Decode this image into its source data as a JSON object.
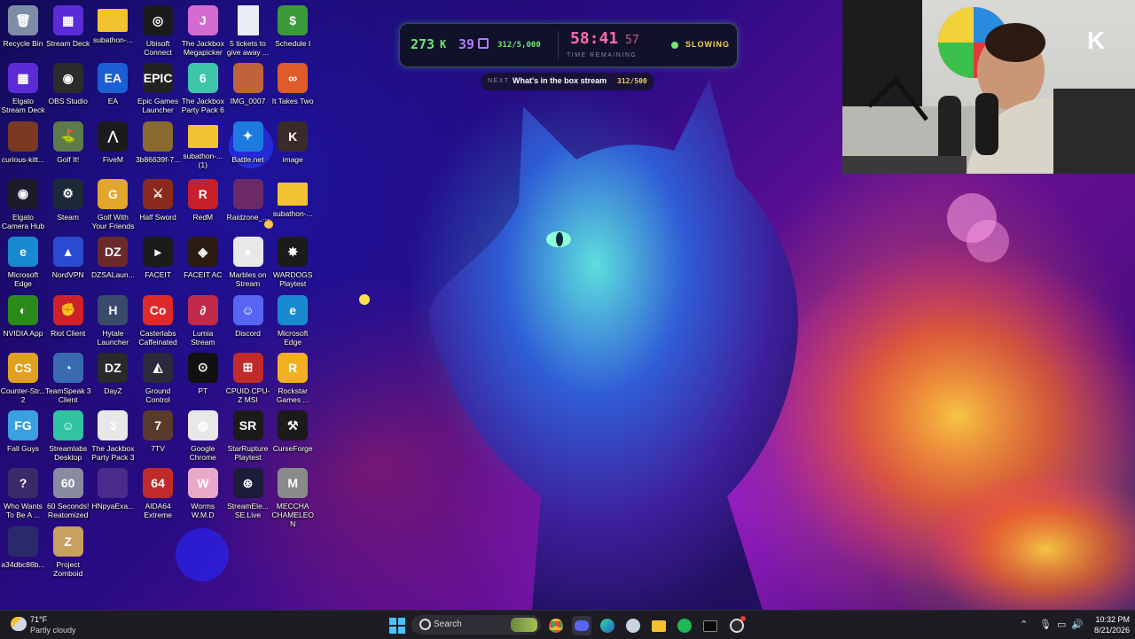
{
  "desktop": {
    "icons": [
      {
        "label": "Recycle Bin",
        "icon": "recycle-bin-icon",
        "color": "#7d8da6",
        "glyph": "🗑"
      },
      {
        "label": "Stream Deck",
        "icon": "stream-deck-icon",
        "color": "#5b2bd6",
        "glyph": "▦"
      },
      {
        "label": "subathon-...",
        "icon": "folder-icon",
        "color": "#f2c230",
        "glyph": ""
      },
      {
        "label": "Ubisoft Connect",
        "icon": "ubisoft-icon",
        "color": "#1a1a1a",
        "glyph": "◎"
      },
      {
        "label": "The Jackbox Megapicker",
        "icon": "jackbox-icon",
        "color": "#d36bd0",
        "glyph": "J"
      },
      {
        "label": "5 tickets to give away ...",
        "icon": "text-document-icon",
        "color": "#e9eef4",
        "glyph": ""
      },
      {
        "label": "Schedule I",
        "icon": "schedule-icon",
        "color": "#3a9a3a",
        "glyph": "$"
      },
      {
        "label": "Elgato Stream Deck",
        "icon": "stream-deck-icon",
        "color": "#5b2bd6",
        "glyph": "▦"
      },
      {
        "label": "OBS Studio",
        "icon": "obs-icon",
        "color": "#2b2b2b",
        "glyph": "◉"
      },
      {
        "label": "EA",
        "icon": "ea-icon",
        "color": "#1b5fd3",
        "glyph": "EA"
      },
      {
        "label": "Epic Games Launcher",
        "icon": "epic-games-icon",
        "color": "#222222",
        "glyph": "EPIC"
      },
      {
        "label": "The Jackbox Party Pack 6",
        "icon": "jackbox-icon",
        "color": "#3fc6a8",
        "glyph": "6"
      },
      {
        "label": "IMG_0007",
        "icon": "image-file-icon",
        "color": "#c0623a",
        "glyph": ""
      },
      {
        "label": "It Takes Two",
        "icon": "game-icon",
        "color": "#e05a2a",
        "glyph": "∞"
      },
      {
        "label": "curious-kitt...",
        "icon": "image-file-icon",
        "color": "#7a3a22",
        "glyph": ""
      },
      {
        "label": "Golf It!",
        "icon": "golf-it-icon",
        "color": "#5d7b4a",
        "glyph": "⛳"
      },
      {
        "label": "FiveM",
        "icon": "fivem-icon",
        "color": "#1b1b1b",
        "glyph": "⋀"
      },
      {
        "label": "3b86639f-7...",
        "icon": "image-file-icon",
        "color": "#8a6a30",
        "glyph": ""
      },
      {
        "label": "subathon-... (1)",
        "icon": "folder-icon",
        "color": "#f2c230",
        "glyph": ""
      },
      {
        "label": "Battle.net",
        "icon": "battlenet-icon",
        "color": "#1d7be0",
        "glyph": "✦"
      },
      {
        "label": "image",
        "icon": "image-file-icon",
        "color": "#3a2a2a",
        "glyph": "K"
      },
      {
        "label": "Elgato Camera Hub",
        "icon": "camera-hub-icon",
        "color": "#1b1b2a",
        "glyph": "◉"
      },
      {
        "label": "Steam",
        "icon": "steam-icon",
        "color": "#1b2838",
        "glyph": "⚙"
      },
      {
        "label": "Golf With Your Friends",
        "icon": "golf-icon",
        "color": "#e2a62a",
        "glyph": "G"
      },
      {
        "label": "Half Sword",
        "icon": "half-sword-icon",
        "color": "#8a2a1a",
        "glyph": "⚔"
      },
      {
        "label": "RedM",
        "icon": "redm-icon",
        "color": "#c8202a",
        "glyph": "R"
      },
      {
        "label": "Raidzone_...",
        "icon": "image-file-icon",
        "color": "#6a2a6a",
        "glyph": ""
      },
      {
        "label": "subathon-...",
        "icon": "folder-icon",
        "color": "#f2c230",
        "glyph": ""
      },
      {
        "label": "Microsoft Edge",
        "icon": "edge-icon",
        "color": "#1a8ad0",
        "glyph": "e"
      },
      {
        "label": "NordVPN",
        "icon": "nordvpn-icon",
        "color": "#2a4ad0",
        "glyph": "▲"
      },
      {
        "label": "DZSALaun...",
        "icon": "dzsa-icon",
        "color": "#6a2a2a",
        "glyph": "DZ"
      },
      {
        "label": "FACEIT",
        "icon": "faceit-icon",
        "color": "#1b1b1b",
        "glyph": "▸"
      },
      {
        "label": "FACEIT AC",
        "icon": "faceit-ac-icon",
        "color": "#2a1b10",
        "glyph": "◈"
      },
      {
        "label": "Marbles on Stream",
        "icon": "marbles-icon",
        "color": "#e8e8e8",
        "glyph": "●"
      },
      {
        "label": "WARDOGS Playtest",
        "icon": "wardogs-icon",
        "color": "#1b1b1b",
        "glyph": "✸"
      },
      {
        "label": "NVIDIA App",
        "icon": "nvidia-icon",
        "color": "#2a8a1a",
        "glyph": "◐"
      },
      {
        "label": "Riot Client",
        "icon": "riot-icon",
        "color": "#d0202a",
        "glyph": "✊"
      },
      {
        "label": "Hytale Launcher",
        "icon": "hytale-icon",
        "color": "#3a4a6a",
        "glyph": "H"
      },
      {
        "label": "Casterlabs Caffeinated",
        "icon": "casterlabs-icon",
        "color": "#e02a2a",
        "glyph": "Co"
      },
      {
        "label": "Lumia Stream",
        "icon": "lumia-icon",
        "color": "#c02a4a",
        "glyph": "∂"
      },
      {
        "label": "Discord",
        "icon": "discord-icon",
        "color": "#5865f2",
        "glyph": "☺"
      },
      {
        "label": "Microsoft Edge",
        "icon": "edge-icon",
        "color": "#1a8ad0",
        "glyph": "e"
      },
      {
        "label": "Counter-Str... 2",
        "icon": "cs2-icon",
        "color": "#e0a020",
        "glyph": "CS"
      },
      {
        "label": "TeamSpeak 3 Client",
        "icon": "teamspeak-icon",
        "color": "#3a6ab0",
        "glyph": "◔"
      },
      {
        "label": "DayZ",
        "icon": "dayz-icon",
        "color": "#2a2a2a",
        "glyph": "DZ"
      },
      {
        "label": "Ground Control",
        "icon": "ground-control-icon",
        "color": "#2a2a3a",
        "glyph": "◭"
      },
      {
        "label": "PT",
        "icon": "pt-icon",
        "color": "#111111",
        "glyph": "⊙"
      },
      {
        "label": "CPUID CPU-Z MSI",
        "icon": "cpuz-icon",
        "color": "#c02a2a",
        "glyph": "⊞"
      },
      {
        "label": "Rockstar Games ...",
        "icon": "rockstar-icon",
        "color": "#f2b020",
        "glyph": "R"
      },
      {
        "label": "Fall Guys",
        "icon": "fall-guys-icon",
        "color": "#3aa0e0",
        "glyph": "FG"
      },
      {
        "label": "Streamlabs Desktop",
        "icon": "streamlabs-icon",
        "color": "#31c3a2",
        "glyph": "☺"
      },
      {
        "label": "The Jackbox Party Pack 3",
        "icon": "jackbox-icon",
        "color": "#e8e8e8",
        "glyph": "3"
      },
      {
        "label": "7TV",
        "icon": "seventv-icon",
        "color": "#5a3a2a",
        "glyph": "7"
      },
      {
        "label": "Google Chrome",
        "icon": "chrome-icon",
        "color": "#e8e8e8",
        "glyph": "◍"
      },
      {
        "label": "StarRupture Playtest",
        "icon": "starrupture-icon",
        "color": "#1b1b1b",
        "glyph": "SR"
      },
      {
        "label": "CurseForge",
        "icon": "curseforge-icon",
        "color": "#1b1b1b",
        "glyph": "⚒"
      },
      {
        "label": "Who Wants To Be A ...",
        "icon": "millionaire-icon",
        "color": "#3a2a6a",
        "glyph": "?"
      },
      {
        "label": "60 Seconds! Reatomized",
        "icon": "sixty-seconds-icon",
        "color": "#8a8aa0",
        "glyph": "60"
      },
      {
        "label": "HNpyaExa...",
        "icon": "image-file-icon",
        "color": "#4a2a8a",
        "glyph": ""
      },
      {
        "label": "AIDA64 Extreme",
        "icon": "aida64-icon",
        "color": "#c02a2a",
        "glyph": "64"
      },
      {
        "label": "Worms W.M.D",
        "icon": "worms-icon",
        "color": "#e8a8c8",
        "glyph": "W"
      },
      {
        "label": "StreamEle... SE.Live",
        "icon": "streamelements-icon",
        "color": "#1b1b3a",
        "glyph": "⊛"
      },
      {
        "label": "MECCHA CHAMELEON",
        "icon": "meccha-icon",
        "color": "#8a8a8a",
        "glyph": "M"
      },
      {
        "label": "a34dbc86b...",
        "icon": "image-file-icon",
        "color": "#2a2a6a",
        "glyph": ""
      },
      {
        "label": "Project Zomboid",
        "icon": "zomboid-icon",
        "color": "#c8a060",
        "glyph": "Z"
      }
    ]
  },
  "overlay": {
    "followers": "273",
    "followers_suffix": "K",
    "subs": "39",
    "sub_goal": "312/5,000",
    "timer_main": "58:41",
    "timer_seconds": "57",
    "timer_caption": "TIME REMAINING",
    "status": "SLOWING",
    "next_label": "NEXT",
    "next_goal": "What's in the box stream",
    "next_progress": "312/500",
    "accent_green": "#6ee86e",
    "accent_pink": "#ff6aa8",
    "accent_purple": "#b07bff",
    "accent_gold": "#f2d25a"
  },
  "taskbar": {
    "weather_temp": "71°F",
    "weather_desc": "Partly cloudy",
    "search_placeholder": "Search",
    "time": "10:32 PM",
    "date": "8/21/2026",
    "pinned": [
      "start-icon",
      "search-icon",
      "chrome-icon",
      "discord-icon",
      "edge-icon",
      "steam-icon",
      "file-explorer-icon",
      "spotify-icon",
      "terminal-icon",
      "obs-icon"
    ]
  }
}
